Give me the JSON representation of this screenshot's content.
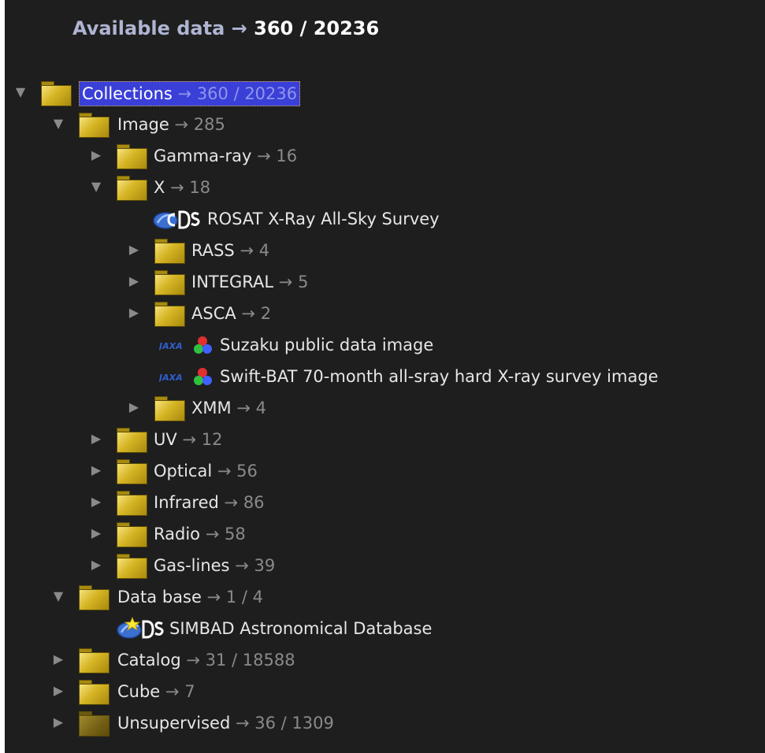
{
  "header": {
    "text": "Available data",
    "arrow": "→",
    "count": "360 / 20236"
  },
  "colors": {
    "background": "#1e1e1e",
    "selection": "#3a3fd8",
    "folder": "#d5b424",
    "count_text": "#8a8a8a"
  },
  "tree": {
    "collections": {
      "label": "Collections",
      "arrow": "→",
      "count": "360 / 20236",
      "expanded": true,
      "selected": true
    },
    "image": {
      "label": "Image",
      "arrow": "→",
      "count": "285",
      "expanded": true
    },
    "gamma": {
      "label": "Gamma-ray",
      "arrow": "→",
      "count": "16",
      "expanded": false
    },
    "x": {
      "label": "X",
      "arrow": "→",
      "count": "18",
      "expanded": true
    },
    "rosat": {
      "label": "ROSAT X-Ray All-Sky Survey",
      "icon": "cds-logo-icon"
    },
    "rass": {
      "label": "RASS",
      "arrow": "→",
      "count": "4",
      "expanded": false
    },
    "integral": {
      "label": "INTEGRAL",
      "arrow": "→",
      "count": "5",
      "expanded": false
    },
    "asca": {
      "label": "ASCA",
      "arrow": "→",
      "count": "2",
      "expanded": false
    },
    "suzaku": {
      "label": "Suzaku public data image",
      "icon": "jaxa-rgb-icon"
    },
    "swift": {
      "label": "Swift-BAT 70-month all-sray hard X-ray survey image",
      "icon": "jaxa-rgb-icon"
    },
    "xmm": {
      "label": "XMM",
      "arrow": "→",
      "count": "4",
      "expanded": false
    },
    "uv": {
      "label": "UV",
      "arrow": "→",
      "count": "12",
      "expanded": false
    },
    "optical": {
      "label": "Optical",
      "arrow": "→",
      "count": "56",
      "expanded": false
    },
    "infrared": {
      "label": "Infrared",
      "arrow": "→",
      "count": "86",
      "expanded": false
    },
    "radio": {
      "label": "Radio",
      "arrow": "→",
      "count": "58",
      "expanded": false
    },
    "gaslines": {
      "label": "Gas-lines",
      "arrow": "→",
      "count": "39",
      "expanded": false
    },
    "database": {
      "label": "Data base",
      "arrow": "→",
      "count": "1 / 4",
      "expanded": true
    },
    "simbad": {
      "label": "SIMBAD Astronomical Database",
      "icon": "cds-star-logo-icon"
    },
    "catalog": {
      "label": "Catalog",
      "arrow": "→",
      "count": "31 / 18588",
      "expanded": false
    },
    "cube": {
      "label": "Cube",
      "arrow": "→",
      "count": "7",
      "expanded": false
    },
    "unsupervised": {
      "label": "Unsupervised",
      "arrow": "→",
      "count": "36 / 1309",
      "expanded": false
    }
  }
}
